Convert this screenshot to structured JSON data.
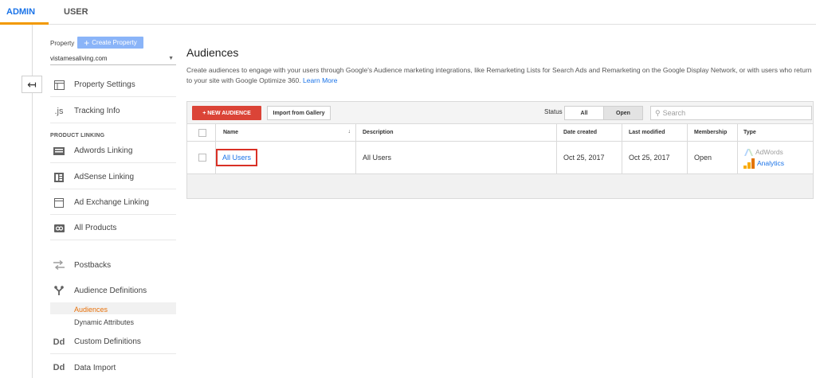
{
  "tabs": {
    "admin": "ADMIN",
    "user": "USER"
  },
  "property": {
    "label": "Property",
    "create_label": "Create Property",
    "selected": "vistamesaliving.com"
  },
  "nav": {
    "property_settings": "Property Settings",
    "tracking_info": "Tracking Info",
    "section_product_linking": "PRODUCT LINKING",
    "adwords_linking": "Adwords Linking",
    "adsense_linking": "AdSense Linking",
    "ad_exchange_linking": "Ad Exchange Linking",
    "all_products": "All Products",
    "postbacks": "Postbacks",
    "audience_definitions": "Audience Definitions",
    "audiences": "Audiences",
    "dynamic_attributes": "Dynamic Attributes",
    "custom_definitions": "Custom Definitions",
    "data_import": "Data Import",
    "icons": {
      "tracking": ".js",
      "custom_definitions": "Dd",
      "data_import": "Dd"
    }
  },
  "main": {
    "title": "Audiences",
    "description": "Create audiences to engage with your users through Google's Audience marketing integrations, like Remarketing Lists for Search Ads and Remarketing on the Google Display Network, or with users who return to your site with Google Optimize 360.",
    "learn_more": "Learn More",
    "toolbar": {
      "new_audience": "+ NEW AUDIENCE",
      "import_gallery": "Import from Gallery",
      "status_label": "Status",
      "status_all": "All",
      "status_open": "Open",
      "search_placeholder": "Search"
    },
    "columns": {
      "name": "Name",
      "description": "Description",
      "date_created": "Date created",
      "last_modified": "Last modified",
      "membership": "Membership",
      "type": "Type"
    },
    "rows": [
      {
        "name": "All Users",
        "description": "All Users",
        "date_created": "Oct 25, 2017",
        "last_modified": "Oct 25, 2017",
        "membership": "Open",
        "types": [
          "AdWords",
          "Analytics"
        ]
      }
    ]
  },
  "colors": {
    "accent_blue": "#1a73e8",
    "new_button_red": "#db4437",
    "tab_orange": "#f29900",
    "active_nav_orange": "#e8710a",
    "highlight_box_red": "#d93025"
  }
}
